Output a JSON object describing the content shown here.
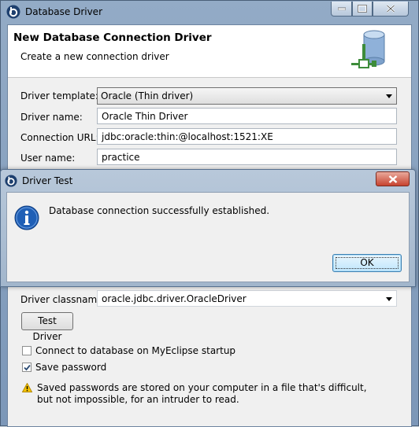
{
  "main_window": {
    "title": "Database Driver",
    "banner_title": "New Database Connection Driver",
    "banner_subtitle": "Create a new connection driver",
    "form": {
      "driver_template_label": "Driver template:",
      "driver_template_value": "Oracle (Thin driver)",
      "driver_name_label": "Driver name:",
      "driver_name_value": "Oracle Thin Driver",
      "connection_url_label": "Connection URL:",
      "connection_url_value": "jdbc:oracle:thin:@localhost:1521:XE",
      "user_name_label": "User name:",
      "user_name_value": "practice",
      "driver_classname_label": "Driver classname:",
      "driver_classname_value": "oracle.jdbc.driver.OracleDriver"
    },
    "test_driver_button": "Test Driver",
    "connect_on_startup_label": "Connect to database on MyEclipse startup",
    "connect_on_startup_checked": false,
    "save_password_label": "Save password",
    "save_password_checked": true,
    "warning_text": "Saved passwords are stored on your computer in a file that's difficult, but not impossible, for an intruder to read."
  },
  "dialog": {
    "title": "Driver Test",
    "message": "Database connection successfully established.",
    "ok_button": "OK"
  },
  "icons": {
    "app": "myeclipse-app-icon",
    "banner": "database-connection-icon",
    "info": "information-icon",
    "warning": "warning-icon"
  },
  "colors": {
    "title_bar": "#93abc6",
    "dialog_close": "#c7432f",
    "info_icon": "#1f5fb6"
  }
}
